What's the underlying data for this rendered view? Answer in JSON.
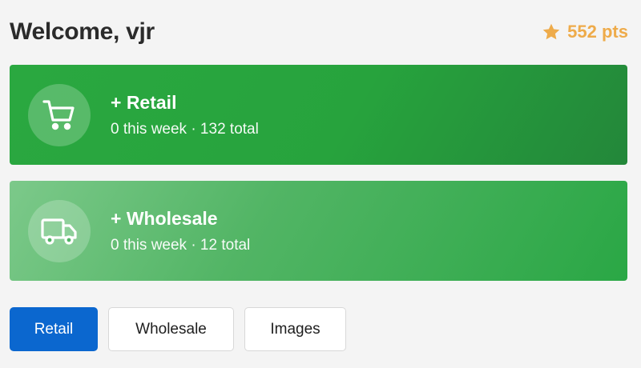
{
  "header": {
    "welcome": "Welcome, vjr",
    "points": "552 pts",
    "points_icon": "star-icon"
  },
  "cards": [
    {
      "title": "+ Retail",
      "subtitle": "0 this week · 132 total",
      "icon": "cart-icon"
    },
    {
      "title": "+ Wholesale",
      "subtitle": "0 this week · 12 total",
      "icon": "truck-icon"
    }
  ],
  "tabs": [
    {
      "label": "Retail",
      "active": true
    },
    {
      "label": "Wholesale",
      "active": false
    },
    {
      "label": "Images",
      "active": false
    }
  ],
  "colors": {
    "accent_blue": "#0b67cf",
    "retail_green": "#27a33d",
    "wholesale_green": "#52b565",
    "points_orange": "#eeab4a"
  }
}
